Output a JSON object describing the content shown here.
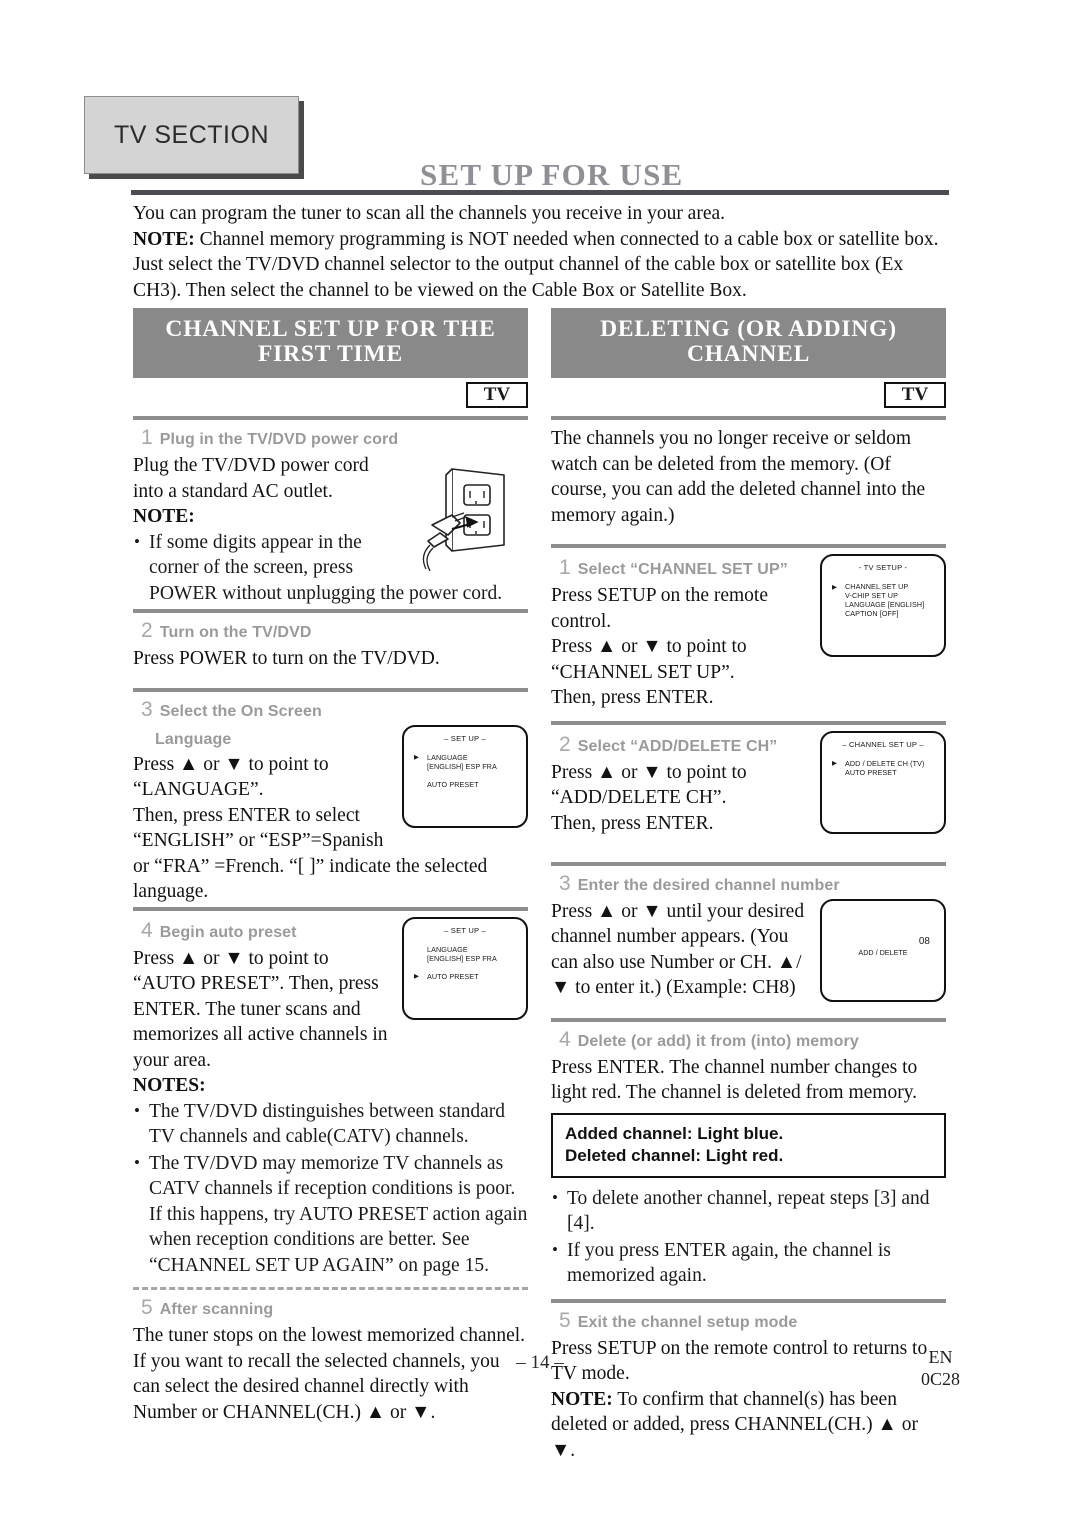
{
  "tab": {
    "label": "TV SECTION"
  },
  "header": {
    "title": "SET UP FOR USE"
  },
  "intro": {
    "line1": "You can program the tuner to scan all the channels you receive in your area.",
    "note_label": "NOTE:",
    "note_text": " Channel memory programming is NOT needed when connected to a cable box or satellite box. Just select the TV/DVD channel selector to the output channel of the cable box or satellite box (Ex CH3). Then select the channel to be viewed on the Cable Box or Satellite Box."
  },
  "left_column": {
    "banner": "CHANNEL SET UP FOR THE FIRST TIME",
    "badge": "TV",
    "steps": [
      {
        "num": "1",
        "title": "Plug in the TV/DVD power cord",
        "body": "Plug the TV/DVD power cord into a standard AC outlet.",
        "note_label": "NOTE:",
        "bullets": [
          "If some digits appear in the corner of the screen, press POWER without unplugging the power cord."
        ]
      },
      {
        "num": "2",
        "title": "Turn on the TV/DVD",
        "body": "Press POWER to turn on the TV/DVD."
      },
      {
        "num": "3",
        "title": "Select the On Screen",
        "title2": "Language",
        "body1": "Press ▲ or ▼ to point to “LANGUAGE”.",
        "body2": "Then, press ENTER to select “ENGLISH”  or “ESP”=Spanish or “FRA” =French. “[ ]” indicate the selected language."
      },
      {
        "num": "4",
        "title": "Begin auto preset",
        "body": "Press ▲ or ▼ to point to “AUTO PRESET”. Then, press ENTER. The tuner scans and memorizes all active channels in your area.",
        "notes_label": "NOTES:",
        "bullets": [
          "The TV/DVD distinguishes between standard TV channels and cable(CATV) channels.",
          "The TV/DVD may memorize TV channels as CATV channels if reception conditions is poor. If this happens, try AUTO PRESET action again when reception conditions are better. See “CHANNEL SET UP AGAIN” on page 15."
        ]
      },
      {
        "num": "5",
        "title": "After scanning",
        "body1": "The tuner stops on the lowest memorized channel.",
        "body2": "If you want to recall the selected channels, you can select the desired channel directly with Number or CHANNEL(CH.) ▲ or ▼."
      }
    ],
    "osd_language": {
      "title": "– SET UP –",
      "row1": "LANGUAGE",
      "row2": "[ENGLISH]   ESP        FRA",
      "row3": "AUTO PRESET"
    },
    "osd_autopreset": {
      "title": "– SET UP –",
      "row1": "LANGUAGE",
      "row2": "[ENGLISH]   ESP        FRA",
      "row3": "AUTO PRESET"
    }
  },
  "right_column": {
    "banner": "DELETING (OR ADDING) CHANNEL",
    "badge": "TV",
    "intro": "The channels you no longer receive or seldom watch can be deleted from the memory. (Of course, you can add the deleted channel into the memory again.)",
    "steps": [
      {
        "num": "1",
        "title": "Select “CHANNEL SET UP”",
        "body1": "Press SETUP on the remote control.",
        "body2": "Press ▲ or ▼ to point to “CHANNEL SET UP”.",
        "body3": "Then, press ENTER."
      },
      {
        "num": "2",
        "title": "Select “ADD/DELETE CH”",
        "body1": "Press ▲ or ▼ to point to “ADD/DELETE CH”.",
        "body2": "Then, press ENTER."
      },
      {
        "num": "3",
        "title": "Enter the desired channel number",
        "body": "Press ▲ or ▼ until your desired channel number appears. (You can also use Number or CH. ▲/▼ to enter it.) (Example: CH8)"
      },
      {
        "num": "4",
        "title": "Delete (or add) it from (into) memory",
        "body": "Press ENTER. The channel number changes to light red. The channel is deleted from memory.",
        "callout_line1": "Added channel: Light blue.",
        "callout_line2": "Deleted channel: Light red.",
        "bullets": [
          "To delete another channel, repeat steps [3] and [4].",
          "If you press ENTER again, the channel is memorized again."
        ]
      },
      {
        "num": "5",
        "title": "Exit the channel setup mode",
        "body": "Press SETUP on the remote control to returns to TV mode.",
        "note_label": "NOTE:",
        "note_text": " To confirm that channel(s) has been deleted or added, press CHANNEL(CH.) ▲ or ▼."
      }
    ],
    "osd_tv_setup": {
      "title": "- TV SETUP -",
      "row1": "CHANNEL SET UP",
      "row2": "V-CHIP SET UP",
      "row3": "LANGUAGE  [ENGLISH]",
      "row4": "CAPTION  [OFF]"
    },
    "osd_channel_setup": {
      "title": "– CHANNEL SET UP –",
      "row1": "ADD / DELETE CH (TV)",
      "row2": "AUTO PRESET"
    },
    "osd_add_delete": {
      "number": "08",
      "label": "ADD / DELETE"
    }
  },
  "footer": {
    "page_number": "– 14 –",
    "lang_code": "EN",
    "doc_code": "0C28"
  },
  "colors": {
    "banner_bg": "#898989",
    "tab_bg": "#d4d4d4",
    "title_gray": "#8f8f96",
    "step_head_gray": "#9a9a9a"
  }
}
